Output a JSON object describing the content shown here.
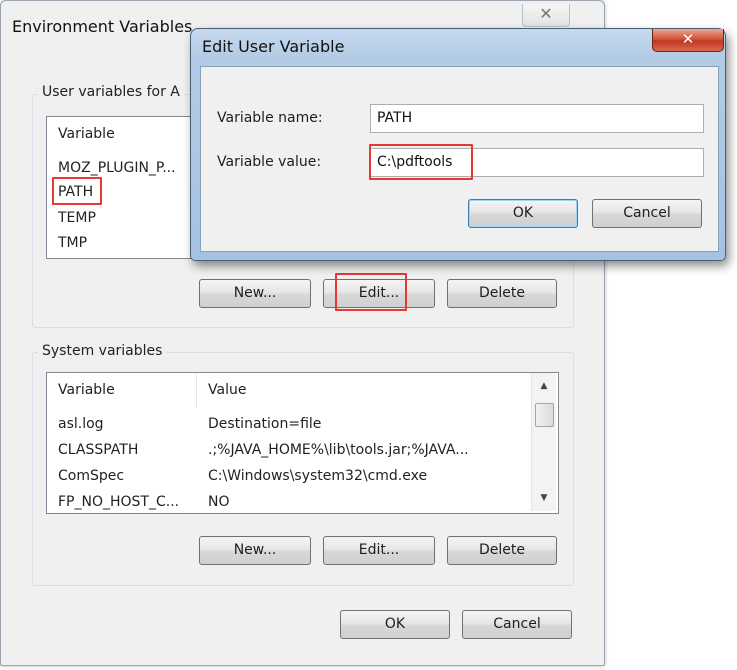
{
  "env_window": {
    "title": "Environment Variables",
    "user_group_label": "User variables for A",
    "user_list": {
      "column_variable": "Variable",
      "rows": [
        "MOZ_PLUGIN_P...",
        "PATH",
        "TEMP",
        "TMP"
      ]
    },
    "user_buttons": {
      "new": "New...",
      "edit": "Edit...",
      "delete": "Delete"
    },
    "system_group_label": "System variables",
    "system_list": {
      "column_variable": "Variable",
      "column_value": "Value",
      "rows": [
        {
          "variable": "asl.log",
          "value": "Destination=file"
        },
        {
          "variable": "CLASSPATH",
          "value": ".;%JAVA_HOME%\\lib\\tools.jar;%JAVA..."
        },
        {
          "variable": "ComSpec",
          "value": "C:\\Windows\\system32\\cmd.exe"
        },
        {
          "variable": "FP_NO_HOST_C...",
          "value": "NO"
        }
      ]
    },
    "system_buttons": {
      "new": "New...",
      "edit": "Edit...",
      "delete": "Delete"
    },
    "ok": "OK",
    "cancel": "Cancel"
  },
  "edit_dialog": {
    "title": "Edit User Variable",
    "name_label": "Variable name:",
    "name_value": "PATH",
    "value_label": "Variable value:",
    "value_value": "C:\\pdftools",
    "ok": "OK",
    "cancel": "Cancel"
  },
  "icons": {
    "close": "close-icon",
    "scroll_up": "arrow-up-icon",
    "scroll_down": "arrow-down-icon"
  },
  "colors": {
    "highlight": "#e53935",
    "dialog_frame": "#a6c2e2",
    "close_red": "#c2371f"
  }
}
